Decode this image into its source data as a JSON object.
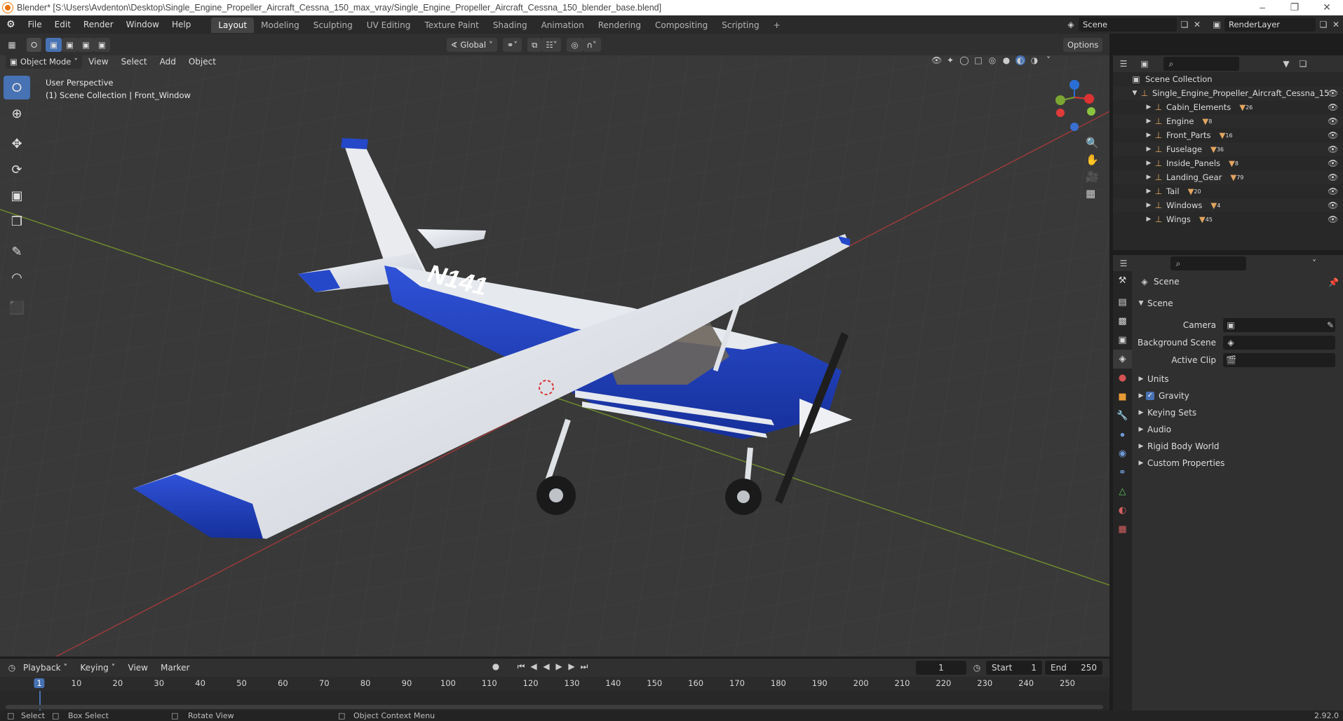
{
  "window": {
    "title": "Blender* [S:\\Users\\Avdenton\\Desktop\\Single_Engine_Propeller_Aircraft_Cessna_150_max_vray/Single_Engine_Propeller_Aircraft_Cessna_150_blender_base.blend]"
  },
  "menu": [
    "File",
    "Edit",
    "Render",
    "Window",
    "Help"
  ],
  "workspaces": [
    "Layout",
    "Modeling",
    "Sculpting",
    "UV Editing",
    "Texture Paint",
    "Shading",
    "Animation",
    "Rendering",
    "Compositing",
    "Scripting"
  ],
  "top_right": {
    "scene": "Scene",
    "render_layer": "RenderLayer"
  },
  "viewport_header": {
    "mode": "Object Mode",
    "menus": [
      "View",
      "Select",
      "Add",
      "Object"
    ],
    "transform": "Global",
    "options": "Options"
  },
  "viewport": {
    "perspective": "User Perspective",
    "collection_info": "(1) Scene Collection | Front_Window",
    "plane_reg": "N141"
  },
  "outliner": {
    "root": "Scene Collection",
    "collection": "Single_Engine_Propeller_Aircraft_Cessna_15",
    "items": [
      {
        "name": "Cabin_Elements",
        "count": "26"
      },
      {
        "name": "Engine",
        "count": "8"
      },
      {
        "name": "Front_Parts",
        "count": "16"
      },
      {
        "name": "Fuselage",
        "count": "36"
      },
      {
        "name": "Inside_Panels",
        "count": "8"
      },
      {
        "name": "Landing_Gear",
        "count": "79"
      },
      {
        "name": "Tail",
        "count": "20"
      },
      {
        "name": "Windows",
        "count": "4"
      },
      {
        "name": "Wings",
        "count": "45"
      }
    ]
  },
  "properties": {
    "header": "Scene",
    "section": "Scene",
    "camera_label": "Camera",
    "bg_label": "Background Scene",
    "clip_label": "Active Clip",
    "panels": [
      "Units",
      "Gravity",
      "Keying Sets",
      "Audio",
      "Rigid Body World",
      "Custom Properties"
    ]
  },
  "timeline": {
    "menus": [
      "Playback",
      "Keying",
      "View",
      "Marker"
    ],
    "current_frame": "1",
    "start_label": "Start",
    "start": "1",
    "end_label": "End",
    "end": "250",
    "ticks": [
      "1",
      "10",
      "20",
      "30",
      "40",
      "50",
      "60",
      "70",
      "80",
      "90",
      "100",
      "110",
      "120",
      "130",
      "140",
      "150",
      "160",
      "170",
      "180",
      "190",
      "200",
      "210",
      "220",
      "230",
      "240",
      "250"
    ]
  },
  "statusbar": {
    "select": "Select",
    "box_select": "Box Select",
    "rotate": "Rotate View",
    "context": "Object Context Menu",
    "version": "2.92.0"
  }
}
